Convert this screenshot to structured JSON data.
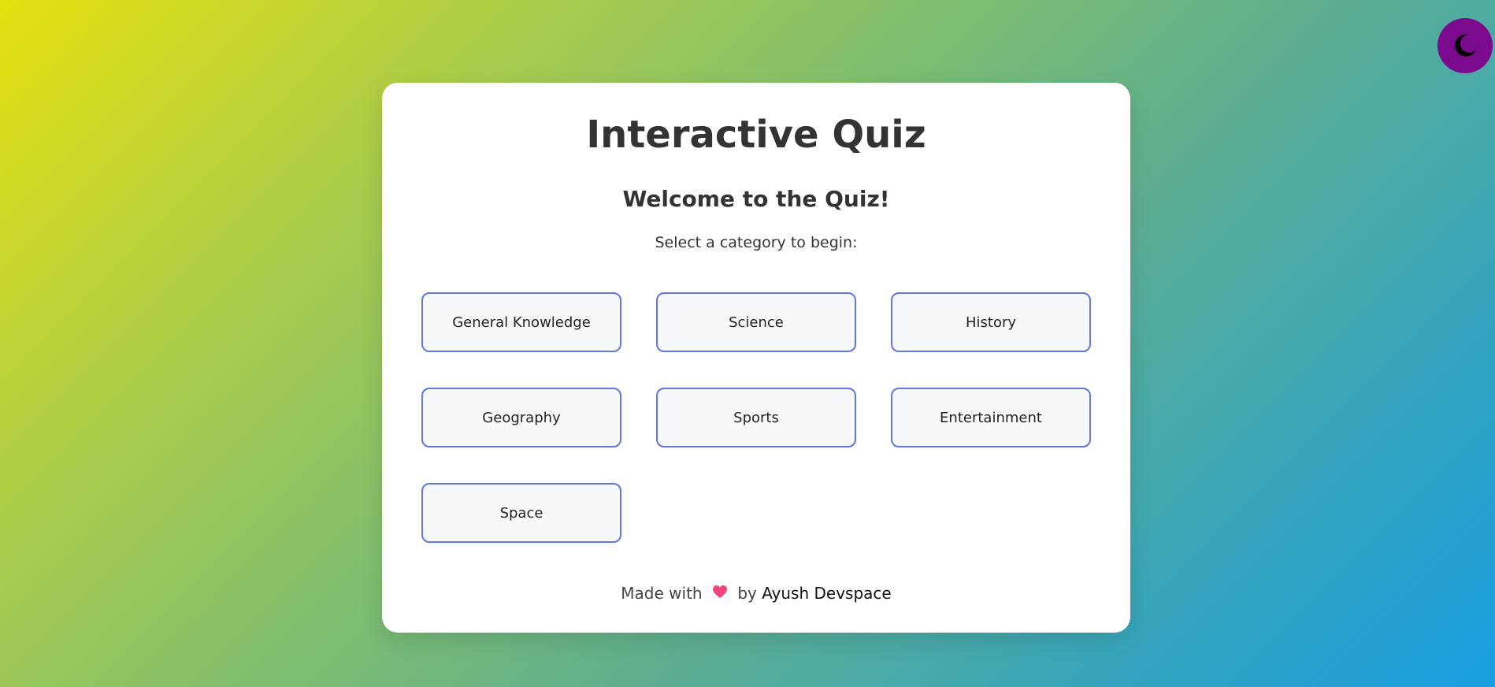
{
  "theme_toggle": {
    "icon": "moon-icon",
    "bg_color": "#7c0a8e"
  },
  "card": {
    "title": "Interactive Quiz",
    "welcome": "Welcome to the Quiz!",
    "subtitle": "Select a category to begin:",
    "categories": [
      {
        "label": "General Knowledge"
      },
      {
        "label": "Science"
      },
      {
        "label": "History"
      },
      {
        "label": "Geography"
      },
      {
        "label": "Sports"
      },
      {
        "label": "Entertainment"
      },
      {
        "label": "Space"
      }
    ]
  },
  "footer": {
    "made_with": "Made with",
    "heart_icon": "heart-icon",
    "by": "by",
    "author": "Ayush Devspace"
  },
  "colors": {
    "accent_border": "#6176e8",
    "button_bg": "#f6f8fa",
    "heart": "#f2457a"
  }
}
